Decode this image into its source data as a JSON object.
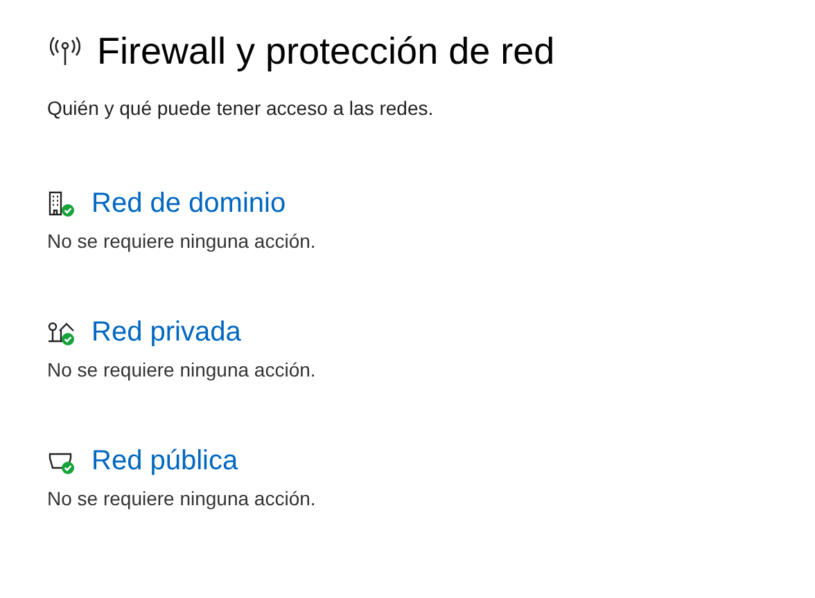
{
  "title": "Firewall y protección de red",
  "subtitle": "Quién y qué puede tener acceso a las redes.",
  "networks": [
    {
      "kind": "domain",
      "name": "Red de dominio",
      "status": "No se requiere ninguna acción.",
      "ok": true
    },
    {
      "kind": "private",
      "name": "Red privada",
      "status": "No se requiere ninguna acción.",
      "ok": true
    },
    {
      "kind": "public",
      "name": "Red pública",
      "status": "No se requiere ninguna acción.",
      "ok": true
    }
  ]
}
